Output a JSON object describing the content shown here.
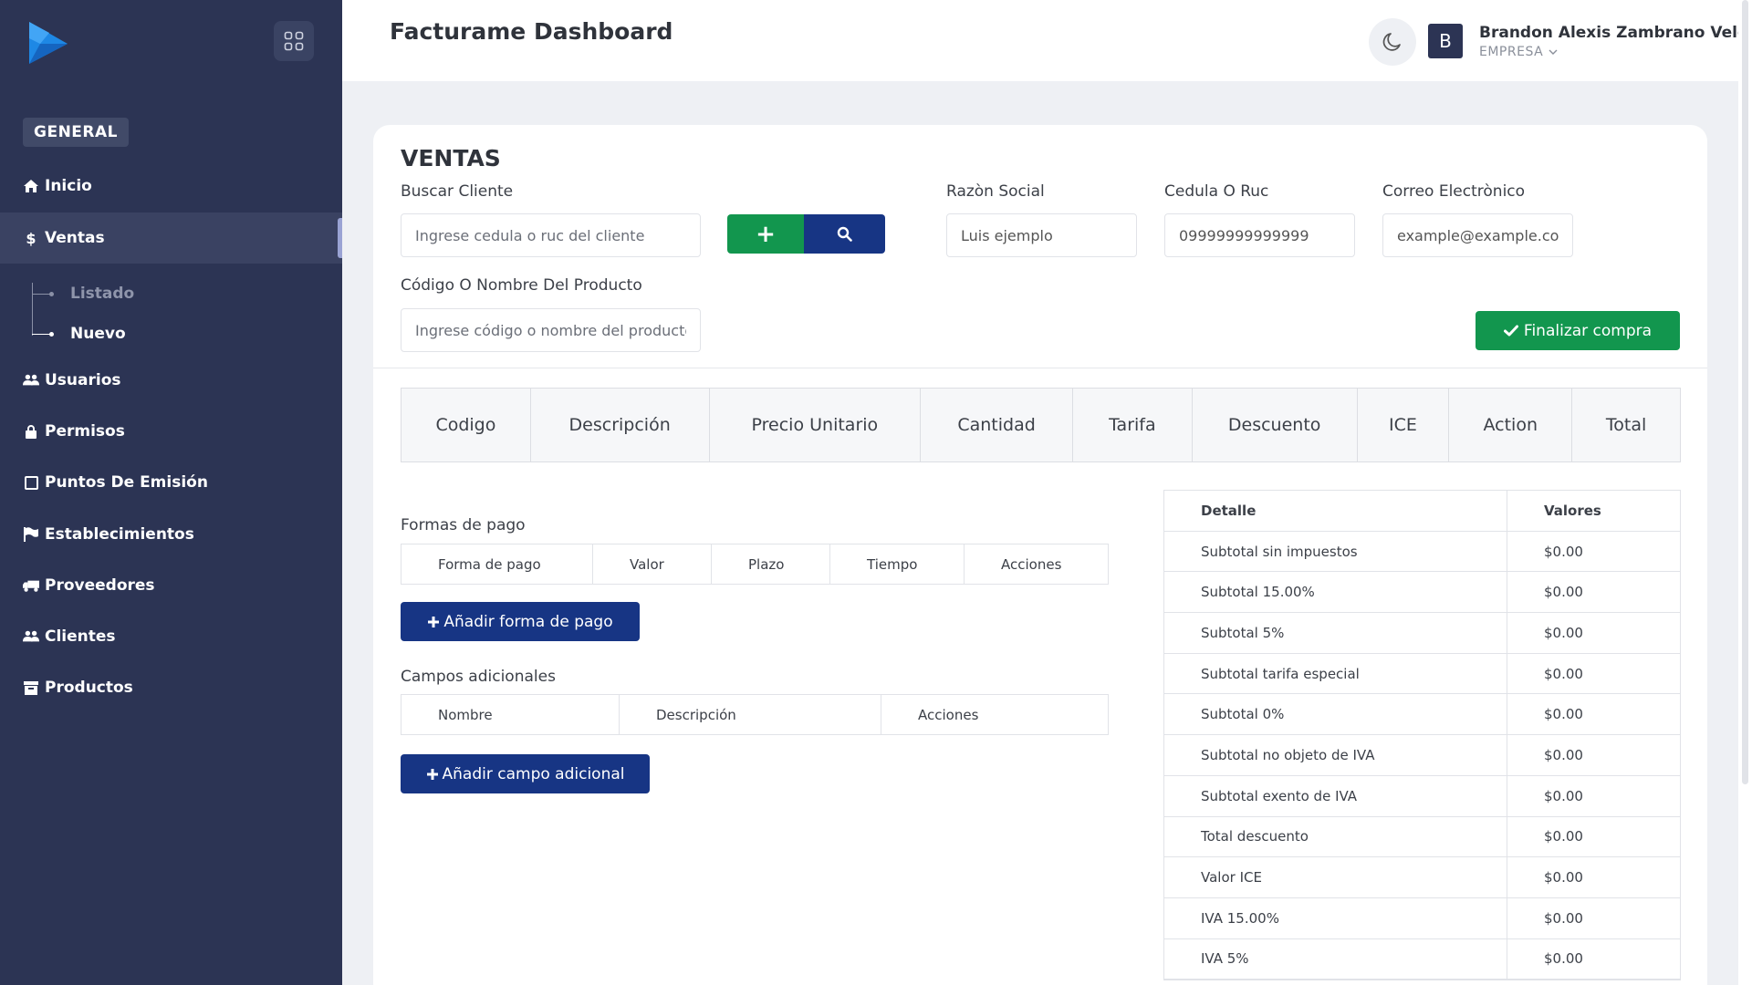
{
  "app": {
    "title": "Facturame Dashboard"
  },
  "sidebar": {
    "section": "GENERAL",
    "items": [
      {
        "label": "Inicio",
        "icon": "home-icon"
      },
      {
        "label": "Ventas",
        "icon": "dollar-icon"
      },
      {
        "label": "Usuarios",
        "icon": "users-icon"
      },
      {
        "label": "Permisos",
        "icon": "lock-icon"
      },
      {
        "label": "Puntos De Emisión",
        "icon": "square-icon"
      },
      {
        "label": "Establecimientos",
        "icon": "flag-icon"
      },
      {
        "label": "Proveedores",
        "icon": "truck-icon"
      },
      {
        "label": "Clientes",
        "icon": "users-icon"
      },
      {
        "label": "Productos",
        "icon": "archive-icon"
      }
    ],
    "sub_items": [
      {
        "label": "Listado"
      },
      {
        "label": "Nuevo"
      }
    ]
  },
  "user": {
    "name": "Brandon Alexis Zambrano Velez",
    "role": "EMPRESA",
    "avatar_letter": "B"
  },
  "ventas": {
    "title": "VENTAS",
    "buscar_label": "Buscar Cliente",
    "buscar_placeholder": "Ingrese cedula o ruc del cliente",
    "add_symbol": "+",
    "razon_label": "Razòn Social",
    "razon_value": "Luis ejemplo",
    "cedula_label": "Cedula O Ruc",
    "cedula_value": "09999999999999",
    "correo_label": "Correo Electrònico",
    "correo_value": "example@example.con",
    "producto_label": "Código O Nombre Del Producto",
    "producto_placeholder": "Ingrese código o nombre del producto",
    "finalizar_label": "Finalizar compra"
  },
  "product_table": {
    "headers": [
      "Codigo",
      "Descripción",
      "Precio Unitario",
      "Cantidad",
      "Tarifa",
      "Descuento",
      "ICE",
      "Action",
      "Total"
    ]
  },
  "formas_pago": {
    "title": "Formas de pago",
    "headers": [
      "Forma de pago",
      "Valor",
      "Plazo",
      "Tiempo",
      "Acciones"
    ],
    "add_label": "Añadir forma de pago"
  },
  "campos_adicionales": {
    "title": "Campos adicionales",
    "headers": [
      "Nombre",
      "Descripción",
      "Acciones"
    ],
    "add_label": "Añadir campo adicional"
  },
  "totals": {
    "headers": [
      "Detalle",
      "Valores"
    ],
    "rows": [
      [
        "Subtotal sin impuestos",
        "$0.00"
      ],
      [
        "Subtotal 15.00%",
        "$0.00"
      ],
      [
        "Subtotal 5%",
        "$0.00"
      ],
      [
        "Subtotal tarifa especial",
        "$0.00"
      ],
      [
        "Subtotal 0%",
        "$0.00"
      ],
      [
        "Subtotal no objeto de IVA",
        "$0.00"
      ],
      [
        "Subtotal exento de IVA",
        "$0.00"
      ],
      [
        "Total descuento",
        "$0.00"
      ],
      [
        "Valor ICE",
        "$0.00"
      ],
      [
        "IVA 15.00%",
        "$0.00"
      ],
      [
        "IVA 5%",
        "$0.00"
      ]
    ]
  },
  "colors": {
    "sidebar": "#2c3454",
    "primary": "#173584",
    "success": "#12964e"
  }
}
